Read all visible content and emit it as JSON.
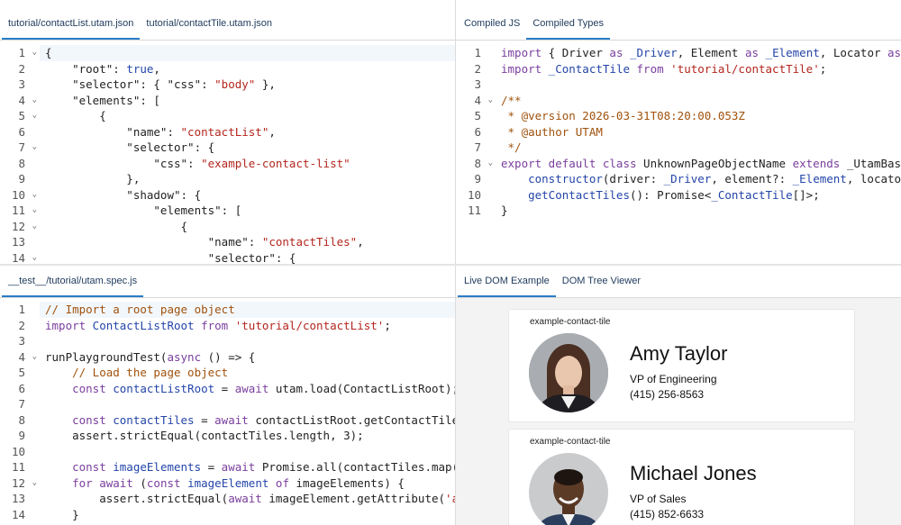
{
  "top_left": {
    "tabs": [
      {
        "label": "tutorial/contactList.utam.json",
        "active": true
      },
      {
        "label": "tutorial/contactTile.utam.json",
        "active": false
      }
    ]
  },
  "top_right": {
    "tabs": [
      {
        "label": "Compiled JS",
        "active": false
      },
      {
        "label": "Compiled Types",
        "active": true
      }
    ]
  },
  "bottom_left": {
    "tabs": [
      {
        "label": "__test__/tutorial/utam.spec.js",
        "active": true
      }
    ]
  },
  "bottom_right": {
    "tabs": [
      {
        "label": "Live DOM Example",
        "active": true
      },
      {
        "label": "DOM Tree Viewer",
        "active": false
      }
    ],
    "tiles": [
      {
        "tag": "example-contact-tile",
        "name": "Amy Taylor",
        "title": "VP of Engineering",
        "phone": "(415) 256-8563"
      },
      {
        "tag": "example-contact-tile",
        "name": "Michael Jones",
        "title": "VP of Sales",
        "phone": "(415) 852-6633"
      }
    ]
  },
  "editors": {
    "json": [
      {
        "n": "1",
        "fold": true,
        "hl": true,
        "tokens": [
          [
            "p",
            "{"
          ]
        ]
      },
      {
        "n": "2",
        "tokens": [
          [
            "p",
            "    \"root\": "
          ],
          [
            "t",
            "true"
          ],
          [
            "p",
            ","
          ]
        ]
      },
      {
        "n": "3",
        "tokens": [
          [
            "p",
            "    \"selector\": { \"css\": "
          ],
          [
            "s",
            "\"body\""
          ],
          [
            "p",
            " },"
          ]
        ]
      },
      {
        "n": "4",
        "fold": true,
        "tokens": [
          [
            "p",
            "    \"elements\": ["
          ]
        ]
      },
      {
        "n": "5",
        "fold": true,
        "tokens": [
          [
            "p",
            "        {"
          ]
        ]
      },
      {
        "n": "6",
        "tokens": [
          [
            "p",
            "            \"name\": "
          ],
          [
            "s",
            "\"contactList\""
          ],
          [
            "p",
            ","
          ]
        ]
      },
      {
        "n": "7",
        "fold": true,
        "tokens": [
          [
            "p",
            "            \"selector\": {"
          ]
        ]
      },
      {
        "n": "8",
        "tokens": [
          [
            "p",
            "                \"css\": "
          ],
          [
            "s",
            "\"example-contact-list\""
          ]
        ]
      },
      {
        "n": "9",
        "tokens": [
          [
            "p",
            "            },"
          ]
        ]
      },
      {
        "n": "10",
        "fold": true,
        "tokens": [
          [
            "p",
            "            \"shadow\": {"
          ]
        ]
      },
      {
        "n": "11",
        "fold": true,
        "tokens": [
          [
            "p",
            "                \"elements\": ["
          ]
        ]
      },
      {
        "n": "12",
        "fold": true,
        "tokens": [
          [
            "p",
            "                    {"
          ]
        ]
      },
      {
        "n": "13",
        "tokens": [
          [
            "p",
            "                        \"name\": "
          ],
          [
            "s",
            "\"contactTiles\""
          ],
          [
            "p",
            ","
          ]
        ]
      },
      {
        "n": "14",
        "fold": true,
        "tokens": [
          [
            "p",
            "                        \"selector\": {"
          ]
        ]
      }
    ],
    "types": [
      {
        "n": "1",
        "tokens": [
          [
            "k",
            "import"
          ],
          [
            "p",
            " { Driver "
          ],
          [
            "k",
            "as"
          ],
          [
            "t",
            " _Driver"
          ],
          [
            "p",
            ", Element "
          ],
          [
            "k",
            "as"
          ],
          [
            "t",
            " _Element"
          ],
          [
            "p",
            ", Locator "
          ],
          [
            "k",
            "as"
          ]
        ]
      },
      {
        "n": "2",
        "tokens": [
          [
            "k",
            "import"
          ],
          [
            "t",
            " _ContactTile"
          ],
          [
            "k",
            " from"
          ],
          [
            "s",
            " 'tutorial/contactTile'"
          ],
          [
            "p",
            ";"
          ]
        ]
      },
      {
        "n": "3",
        "tokens": [
          [
            "p",
            ""
          ]
        ]
      },
      {
        "n": "4",
        "fold": true,
        "tokens": [
          [
            "c",
            "/**"
          ]
        ]
      },
      {
        "n": "5",
        "tokens": [
          [
            "c",
            " * @version 2026-03-31T08:20:00.053Z"
          ]
        ]
      },
      {
        "n": "6",
        "tokens": [
          [
            "c",
            " * @author UTAM"
          ]
        ]
      },
      {
        "n": "7",
        "tokens": [
          [
            "c",
            " */"
          ]
        ]
      },
      {
        "n": "8",
        "fold": true,
        "tokens": [
          [
            "k",
            "export default class"
          ],
          [
            "p",
            " UnknownPageObjectName "
          ],
          [
            "k",
            "extends"
          ],
          [
            "p",
            " _UtamBase"
          ]
        ]
      },
      {
        "n": "9",
        "tokens": [
          [
            "t",
            "    constructor"
          ],
          [
            "p",
            "(driver: "
          ],
          [
            "t",
            "_Driver"
          ],
          [
            "p",
            ", element?: "
          ],
          [
            "t",
            "_Element"
          ],
          [
            "p",
            ", locator"
          ]
        ]
      },
      {
        "n": "10",
        "tokens": [
          [
            "t",
            "    getContactTiles"
          ],
          [
            "p",
            "(): Promise<"
          ],
          [
            "t",
            "_ContactTile"
          ],
          [
            "p",
            "[]>;"
          ]
        ]
      },
      {
        "n": "11",
        "tokens": [
          [
            "p",
            "}"
          ]
        ]
      }
    ],
    "spec": [
      {
        "n": "1",
        "hl": true,
        "tokens": [
          [
            "c",
            "// Import a root page object"
          ]
        ]
      },
      {
        "n": "2",
        "tokens": [
          [
            "k",
            "import"
          ],
          [
            "t",
            " ContactListRoot"
          ],
          [
            "k",
            " from"
          ],
          [
            "s",
            " 'tutorial/contactList'"
          ],
          [
            "p",
            ";"
          ]
        ]
      },
      {
        "n": "3",
        "tokens": [
          [
            "p",
            ""
          ]
        ]
      },
      {
        "n": "4",
        "fold": true,
        "tokens": [
          [
            "p",
            "runPlaygroundTest("
          ],
          [
            "k",
            "async"
          ],
          [
            "p",
            " () => {"
          ]
        ]
      },
      {
        "n": "5",
        "tokens": [
          [
            "c",
            "    // Load the page object"
          ]
        ]
      },
      {
        "n": "6",
        "tokens": [
          [
            "k",
            "    const"
          ],
          [
            "t",
            " contactListRoot"
          ],
          [
            "p",
            " = "
          ],
          [
            "k",
            "await"
          ],
          [
            "p",
            " utam.load(ContactListRoot);"
          ]
        ]
      },
      {
        "n": "7",
        "tokens": [
          [
            "p",
            ""
          ]
        ]
      },
      {
        "n": "8",
        "tokens": [
          [
            "k",
            "    const"
          ],
          [
            "t",
            " contactTiles"
          ],
          [
            "p",
            " = "
          ],
          [
            "k",
            "await"
          ],
          [
            "p",
            " contactListRoot.getContactTile"
          ]
        ]
      },
      {
        "n": "9",
        "tokens": [
          [
            "p",
            "    assert.strictEqual(contactTiles.length, 3);"
          ]
        ]
      },
      {
        "n": "10",
        "tokens": [
          [
            "p",
            ""
          ]
        ]
      },
      {
        "n": "11",
        "tokens": [
          [
            "k",
            "    const"
          ],
          [
            "t",
            " imageElements"
          ],
          [
            "p",
            " = "
          ],
          [
            "k",
            "await"
          ],
          [
            "p",
            " Promise.all(contactTiles.map("
          ]
        ]
      },
      {
        "n": "12",
        "fold": true,
        "tokens": [
          [
            "k",
            "    for await"
          ],
          [
            "p",
            " ("
          ],
          [
            "k",
            "const"
          ],
          [
            "t",
            " imageElement"
          ],
          [
            "k",
            " of"
          ],
          [
            "p",
            " imageElements) {"
          ]
        ]
      },
      {
        "n": "13",
        "tokens": [
          [
            "p",
            "        assert.strictEqual("
          ],
          [
            "k",
            "await"
          ],
          [
            "p",
            " imageElement.getAttribute("
          ],
          [
            "s",
            "'a"
          ]
        ]
      },
      {
        "n": "14",
        "tokens": [
          [
            "p",
            "    }"
          ]
        ]
      }
    ]
  }
}
